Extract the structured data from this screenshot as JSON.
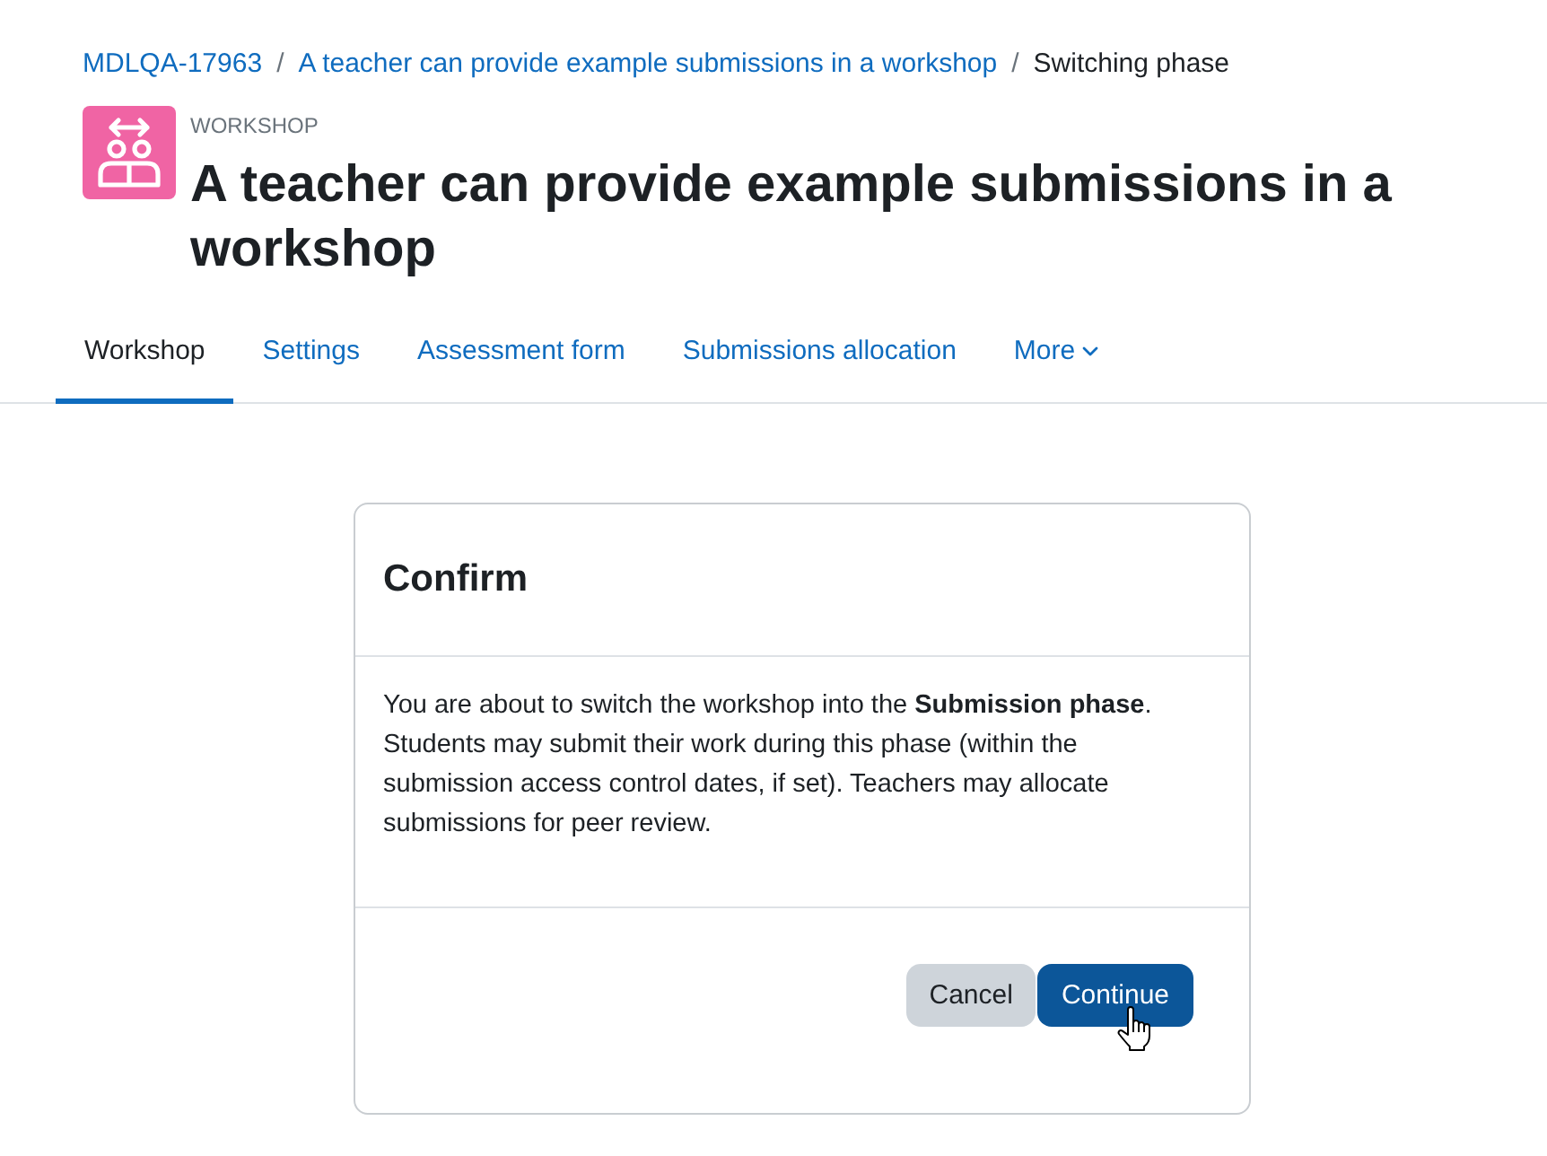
{
  "breadcrumb": [
    {
      "kind": "link",
      "label": "MDLQA-17963"
    },
    {
      "kind": "separator",
      "label": "/"
    },
    {
      "kind": "link",
      "label": "A teacher can provide example submissions in a workshop"
    },
    {
      "kind": "separator",
      "label": "/"
    },
    {
      "kind": "current",
      "label": "Switching phase"
    }
  ],
  "header": {
    "activity_type": "WORKSHOP",
    "title": "A teacher can provide example submissions in a workshop"
  },
  "tabs": [
    {
      "kind": "link",
      "label": "Workshop",
      "selected": true
    },
    {
      "kind": "link",
      "label": "Settings",
      "selected": false
    },
    {
      "kind": "link",
      "label": "Assessment form",
      "selected": false
    },
    {
      "kind": "link",
      "label": "Submissions allocation",
      "selected": false
    },
    {
      "kind": "dropdown",
      "label": "More",
      "selected": false
    }
  ],
  "dialog": {
    "title": "Confirm",
    "message": "You are about to switch the workshop into the **Submission phase**. Students may submit their work during this phase (within the submission access control dates, if set). Teachers may allocate submissions for peer review.",
    "buttons": [
      {
        "kind": "secondary",
        "label": "Cancel"
      },
      {
        "kind": "primary",
        "label": "Continue",
        "hovered": true
      }
    ]
  }
}
